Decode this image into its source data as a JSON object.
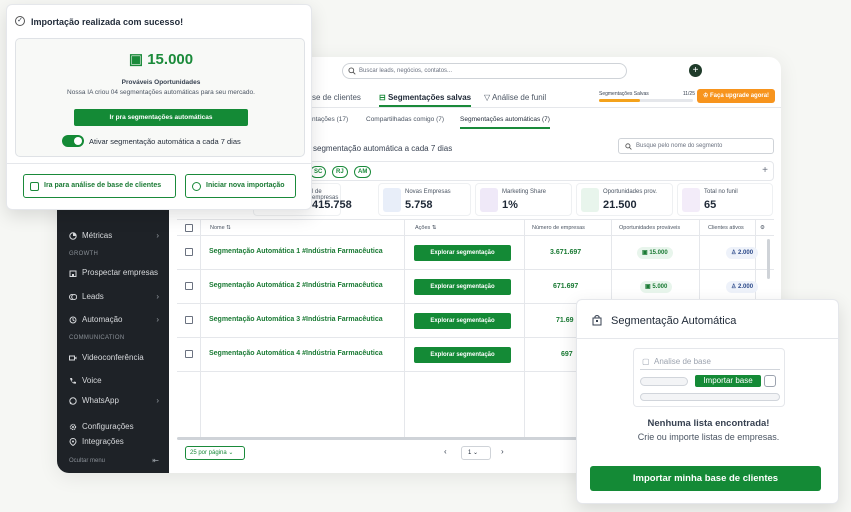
{
  "header": {
    "search_placeholder": "Buscar leads, negócios, contatos...",
    "seg_saved_label": "Segmentações Salvas",
    "seg_saved_count": "11/25",
    "seg_saved_progress": 0.44,
    "upgrade_label": "Faça upgrade agora!"
  },
  "tabs": [
    "se de clientes",
    "Segmentações salvas",
    "Análise de funil"
  ],
  "subtabs": [
    "ntações (17)",
    "Compartilhadas comigo (7)",
    "Segmentações automáticas (7)"
  ],
  "main": {
    "auto_text": "segmentação automática a cada 7 dias",
    "seg_search_placeholder": "Busque pelo nome do segmento",
    "chips": [
      "SC",
      "RJ",
      "AM"
    ]
  },
  "sidebar": {
    "items": [
      {
        "label": "Métricas",
        "icon": "chart-icon"
      },
      {
        "label": "Prospectar empresas",
        "icon": "building-icon"
      },
      {
        "label": "Leads",
        "icon": "coins-icon"
      },
      {
        "label": "Automação",
        "icon": "automation-icon"
      },
      {
        "label": "Videoconferência",
        "icon": "video-icon"
      },
      {
        "label": "Voice",
        "icon": "phone-icon"
      },
      {
        "label": "WhatsApp",
        "icon": "whatsapp-icon"
      },
      {
        "label": "Configurações",
        "icon": "gear-icon"
      },
      {
        "label": "Integrações",
        "icon": "plug-icon"
      }
    ],
    "sections": [
      "GROWTH",
      "COMMUNICATION"
    ],
    "hide_menu": "Ocultar menu"
  },
  "stats": [
    {
      "label": "l de empresas",
      "value": "415.758"
    },
    {
      "label": "Novas Empresas",
      "value": "5.758"
    },
    {
      "label": "Marketing Share",
      "value": "1%"
    },
    {
      "label": "Oportunidades prov.",
      "value": "21.500"
    },
    {
      "label": "Total no funil",
      "value": "65"
    }
  ],
  "table": {
    "headers": [
      "Nome",
      "Ações",
      "Número de empresas",
      "Oportunidades prováveis",
      "Clientes ativos"
    ],
    "explore_label": "Explorar segmentação",
    "rows": [
      {
        "name": "Segmentação Automática 1 #Indústria Farmacêutica",
        "empresas": "3.671.697",
        "oport": "15.000",
        "clientes": "2.000"
      },
      {
        "name": "Segmentação Automática 2 #Indústria Farmacêutica",
        "empresas": "671.697",
        "oport": "5.000",
        "clientes": "2.000"
      },
      {
        "name": "Segmentação Automática 3 #Indústria Farmacêutica",
        "empresas": "71.69",
        "oport": "",
        "clientes": ""
      },
      {
        "name": "Segmentação Automática 4 #Indústria Farmacêutica",
        "empresas": "697",
        "oport": "",
        "clientes": ""
      }
    ],
    "per_page": "25 por página",
    "page": "1"
  },
  "modal": {
    "title": "Importação realizada com sucesso!",
    "big_number": "15.000",
    "sub_title": "Prováveis Oportunidades",
    "sub_text": "Nossa IA criou 04 segmentações automáticas para seu mercado.",
    "go_button": "Ir pra segmentações automáticas",
    "toggle_label": "Ativar segmentação automática a cada 7 dias",
    "toggle_on": true,
    "btn_analysis": "Ira para análise de base de clientes",
    "btn_import": "Iniciar nova importação"
  },
  "seg_card": {
    "title": "Segmentação Automática",
    "mock_label": "Analise de base",
    "mock_button": "Importar base",
    "empty_title": "Nenhuma lista encontrada!",
    "empty_sub": "Crie ou importe listas de empresas.",
    "cta": "Importar minha base de clientes"
  },
  "colors": {
    "brand_green": "#148a36",
    "upgrade_orange": "#f7941d",
    "sidebar_bg": "#1e2227"
  }
}
